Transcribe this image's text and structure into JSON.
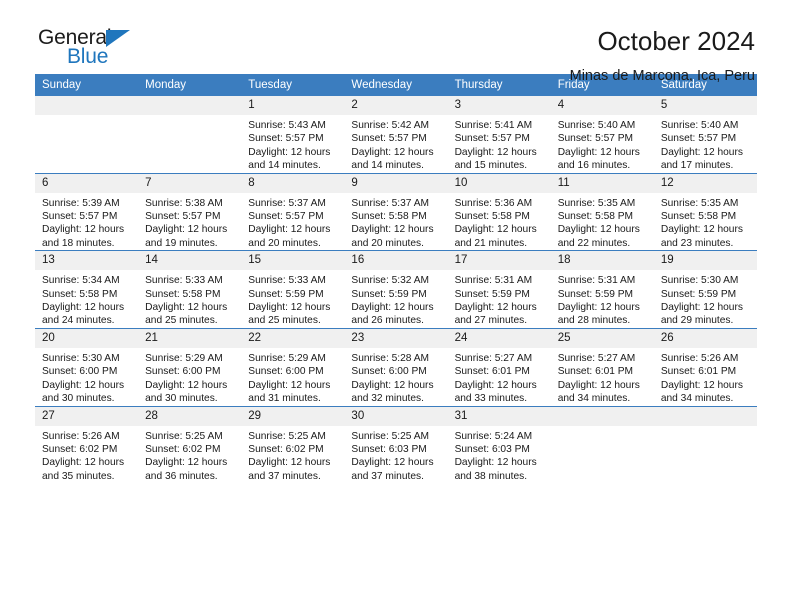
{
  "brand": {
    "name_part1": "General",
    "name_part2": "Blue",
    "triangle_color": "#1f76bd",
    "text_color": "#1b1b1b"
  },
  "header": {
    "title": "October 2024",
    "subtitle": "Minas de Marcona, Ica, Peru"
  },
  "theme": {
    "header_blue": "#3b7dbf",
    "daynum_gray": "#f0f0f0",
    "text": "#1a1a1a"
  },
  "calendar": {
    "weekday_headers": [
      "Sunday",
      "Monday",
      "Tuesday",
      "Wednesday",
      "Thursday",
      "Friday",
      "Saturday"
    ],
    "labels": {
      "sunrise": "Sunrise:",
      "sunset": "Sunset:",
      "daylight": "Daylight:"
    },
    "weeks": [
      [
        {
          "day": "",
          "empty": true
        },
        {
          "day": "",
          "empty": true
        },
        {
          "day": "1",
          "sunrise": "Sunrise: 5:43 AM",
          "sunset": "Sunset: 5:57 PM",
          "daylight": "Daylight: 12 hours and 14 minutes."
        },
        {
          "day": "2",
          "sunrise": "Sunrise: 5:42 AM",
          "sunset": "Sunset: 5:57 PM",
          "daylight": "Daylight: 12 hours and 14 minutes."
        },
        {
          "day": "3",
          "sunrise": "Sunrise: 5:41 AM",
          "sunset": "Sunset: 5:57 PM",
          "daylight": "Daylight: 12 hours and 15 minutes."
        },
        {
          "day": "4",
          "sunrise": "Sunrise: 5:40 AM",
          "sunset": "Sunset: 5:57 PM",
          "daylight": "Daylight: 12 hours and 16 minutes."
        },
        {
          "day": "5",
          "sunrise": "Sunrise: 5:40 AM",
          "sunset": "Sunset: 5:57 PM",
          "daylight": "Daylight: 12 hours and 17 minutes."
        }
      ],
      [
        {
          "day": "6",
          "sunrise": "Sunrise: 5:39 AM",
          "sunset": "Sunset: 5:57 PM",
          "daylight": "Daylight: 12 hours and 18 minutes."
        },
        {
          "day": "7",
          "sunrise": "Sunrise: 5:38 AM",
          "sunset": "Sunset: 5:57 PM",
          "daylight": "Daylight: 12 hours and 19 minutes."
        },
        {
          "day": "8",
          "sunrise": "Sunrise: 5:37 AM",
          "sunset": "Sunset: 5:57 PM",
          "daylight": "Daylight: 12 hours and 20 minutes."
        },
        {
          "day": "9",
          "sunrise": "Sunrise: 5:37 AM",
          "sunset": "Sunset: 5:58 PM",
          "daylight": "Daylight: 12 hours and 20 minutes."
        },
        {
          "day": "10",
          "sunrise": "Sunrise: 5:36 AM",
          "sunset": "Sunset: 5:58 PM",
          "daylight": "Daylight: 12 hours and 21 minutes."
        },
        {
          "day": "11",
          "sunrise": "Sunrise: 5:35 AM",
          "sunset": "Sunset: 5:58 PM",
          "daylight": "Daylight: 12 hours and 22 minutes."
        },
        {
          "day": "12",
          "sunrise": "Sunrise: 5:35 AM",
          "sunset": "Sunset: 5:58 PM",
          "daylight": "Daylight: 12 hours and 23 minutes."
        }
      ],
      [
        {
          "day": "13",
          "sunrise": "Sunrise: 5:34 AM",
          "sunset": "Sunset: 5:58 PM",
          "daylight": "Daylight: 12 hours and 24 minutes."
        },
        {
          "day": "14",
          "sunrise": "Sunrise: 5:33 AM",
          "sunset": "Sunset: 5:58 PM",
          "daylight": "Daylight: 12 hours and 25 minutes."
        },
        {
          "day": "15",
          "sunrise": "Sunrise: 5:33 AM",
          "sunset": "Sunset: 5:59 PM",
          "daylight": "Daylight: 12 hours and 25 minutes."
        },
        {
          "day": "16",
          "sunrise": "Sunrise: 5:32 AM",
          "sunset": "Sunset: 5:59 PM",
          "daylight": "Daylight: 12 hours and 26 minutes."
        },
        {
          "day": "17",
          "sunrise": "Sunrise: 5:31 AM",
          "sunset": "Sunset: 5:59 PM",
          "daylight": "Daylight: 12 hours and 27 minutes."
        },
        {
          "day": "18",
          "sunrise": "Sunrise: 5:31 AM",
          "sunset": "Sunset: 5:59 PM",
          "daylight": "Daylight: 12 hours and 28 minutes."
        },
        {
          "day": "19",
          "sunrise": "Sunrise: 5:30 AM",
          "sunset": "Sunset: 5:59 PM",
          "daylight": "Daylight: 12 hours and 29 minutes."
        }
      ],
      [
        {
          "day": "20",
          "sunrise": "Sunrise: 5:30 AM",
          "sunset": "Sunset: 6:00 PM",
          "daylight": "Daylight: 12 hours and 30 minutes."
        },
        {
          "day": "21",
          "sunrise": "Sunrise: 5:29 AM",
          "sunset": "Sunset: 6:00 PM",
          "daylight": "Daylight: 12 hours and 30 minutes."
        },
        {
          "day": "22",
          "sunrise": "Sunrise: 5:29 AM",
          "sunset": "Sunset: 6:00 PM",
          "daylight": "Daylight: 12 hours and 31 minutes."
        },
        {
          "day": "23",
          "sunrise": "Sunrise: 5:28 AM",
          "sunset": "Sunset: 6:00 PM",
          "daylight": "Daylight: 12 hours and 32 minutes."
        },
        {
          "day": "24",
          "sunrise": "Sunrise: 5:27 AM",
          "sunset": "Sunset: 6:01 PM",
          "daylight": "Daylight: 12 hours and 33 minutes."
        },
        {
          "day": "25",
          "sunrise": "Sunrise: 5:27 AM",
          "sunset": "Sunset: 6:01 PM",
          "daylight": "Daylight: 12 hours and 34 minutes."
        },
        {
          "day": "26",
          "sunrise": "Sunrise: 5:26 AM",
          "sunset": "Sunset: 6:01 PM",
          "daylight": "Daylight: 12 hours and 34 minutes."
        }
      ],
      [
        {
          "day": "27",
          "sunrise": "Sunrise: 5:26 AM",
          "sunset": "Sunset: 6:02 PM",
          "daylight": "Daylight: 12 hours and 35 minutes."
        },
        {
          "day": "28",
          "sunrise": "Sunrise: 5:25 AM",
          "sunset": "Sunset: 6:02 PM",
          "daylight": "Daylight: 12 hours and 36 minutes."
        },
        {
          "day": "29",
          "sunrise": "Sunrise: 5:25 AM",
          "sunset": "Sunset: 6:02 PM",
          "daylight": "Daylight: 12 hours and 37 minutes."
        },
        {
          "day": "30",
          "sunrise": "Sunrise: 5:25 AM",
          "sunset": "Sunset: 6:03 PM",
          "daylight": "Daylight: 12 hours and 37 minutes."
        },
        {
          "day": "31",
          "sunrise": "Sunrise: 5:24 AM",
          "sunset": "Sunset: 6:03 PM",
          "daylight": "Daylight: 12 hours and 38 minutes."
        },
        {
          "day": "",
          "empty": true
        },
        {
          "day": "",
          "empty": true
        }
      ]
    ]
  }
}
